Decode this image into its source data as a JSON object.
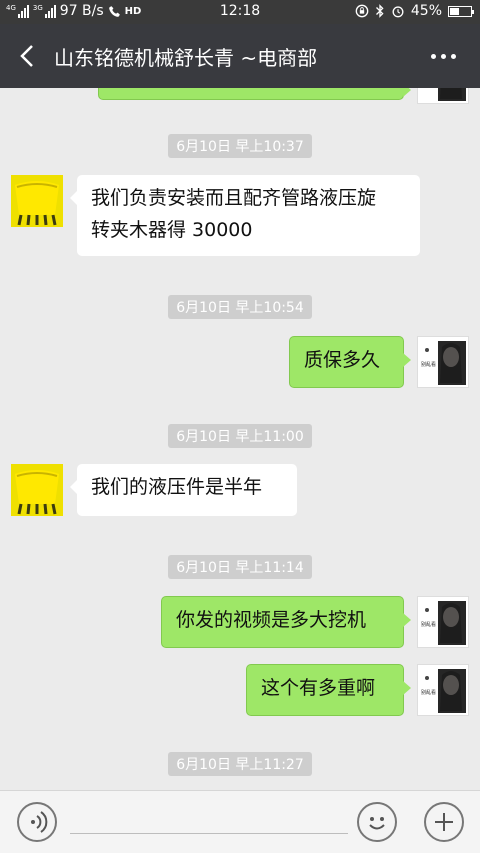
{
  "status_bar": {
    "network_label": "4G",
    "network_label2": "3G",
    "speed": "97 B/s",
    "hd": "HD",
    "time": "12:18",
    "battery": "45%",
    "battery_level": 0.45
  },
  "header": {
    "title": "山东铭德机械舒长青  ~电商部"
  },
  "messages": [
    {
      "type": "time",
      "text": "6月10日 早上10:37"
    },
    {
      "type": "in",
      "lines": [
        "我们负责安装而且配齐管路液压旋",
        "转夹木器得 30000"
      ]
    },
    {
      "type": "time",
      "text": "6月10日 早上10:54"
    },
    {
      "type": "out",
      "text": "质保多久"
    },
    {
      "type": "time",
      "text": "6月10日 早上11:00"
    },
    {
      "type": "in",
      "text": "我们的液压件是半年"
    },
    {
      "type": "time",
      "text": "6月10日 早上11:14"
    },
    {
      "type": "out",
      "text": "你发的视频是多大挖机"
    },
    {
      "type": "out",
      "text": "这个有多重啊"
    },
    {
      "type": "time",
      "text": "6月10日 早上11:27"
    }
  ],
  "avatar_caption": "别乱看",
  "icons": {
    "back": "back-arrow-icon",
    "more": "more-dots-icon",
    "voice": "voice-icon",
    "emoji": "emoji-icon",
    "plus": "plus-icon"
  },
  "colors": {
    "header_bg": "#393a3f",
    "chat_bg": "#ebebeb",
    "out_bubble": "#9ee767",
    "in_bubble": "#ffffff",
    "time_chip": "#cecece"
  }
}
